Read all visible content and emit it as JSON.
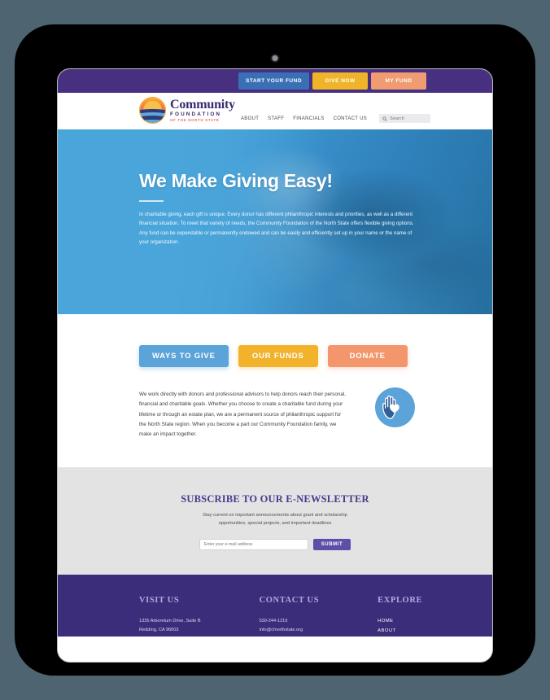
{
  "device": {
    "type": "tablet-mockup",
    "camera": "camera-dot"
  },
  "topbar": {
    "buttons": [
      {
        "label": "START YOUR FUND",
        "color": "#3a6fb5"
      },
      {
        "label": "GIVE NOW",
        "color": "#f0b429"
      },
      {
        "label": "MY FUND",
        "color": "#f09b72"
      }
    ]
  },
  "logo": {
    "line1": "Community",
    "line2": "FOUNDATION",
    "line3": "OF THE NORTH STATE"
  },
  "nav": {
    "links": [
      "ABOUT",
      "STAFF",
      "FINANCIALS",
      "CONTACT US"
    ],
    "search_placeholder": "Search",
    "search_value": ""
  },
  "hero": {
    "title": "We Make Giving Easy!",
    "body": "In charitable giving, each gift is unique. Every donor has different philanthropic interests and priorities, as well as a different financial situation. To meet that variety of needs, the Community Foundation of the North State offers flexible giving options. Any fund can be expendable or permanently endowed and can be easily and efficiently set up in your name or the name of your organization."
  },
  "cta": {
    "buttons": [
      {
        "label": "WAYS TO GIVE",
        "color": "#5ba3d8"
      },
      {
        "label": "OUR FUNDS",
        "color": "#f2b22c"
      },
      {
        "label": "DONATE",
        "color": "#f4966c"
      }
    ]
  },
  "intro": {
    "body": "We work directly with donors and professional advisors to help donors reach their personal, financial and charitable goals. Whether you choose to create a charitable fund during your lifetime or through an estate plan, we are a permanent source of philanthropic support for the North State region. When you become a part our Community Foundation family, we make an impact together.",
    "icon": "hand-heart-icon"
  },
  "newsletter": {
    "title": "SUBSCRIBE TO OUR E-NEWSLETTER",
    "subtitle": "Stay current on important announcements about grant and scholarship opportunities, special projects, and important deadlines",
    "email_placeholder": "Enter your e-mail address",
    "email_value": "",
    "submit_label": "SUBMIT"
  },
  "footer": {
    "visit": {
      "title": "VISIT US",
      "line1": "1335 Arboretum Drive, Suite B",
      "line2": "Redding, CA 96003"
    },
    "contact": {
      "title": "CONTACT US",
      "phone": "530-244-1219",
      "email": "info@cfnorthstate.org"
    },
    "explore": {
      "title": "EXPLORE",
      "links": [
        "HOME",
        "ABOUT"
      ]
    }
  }
}
